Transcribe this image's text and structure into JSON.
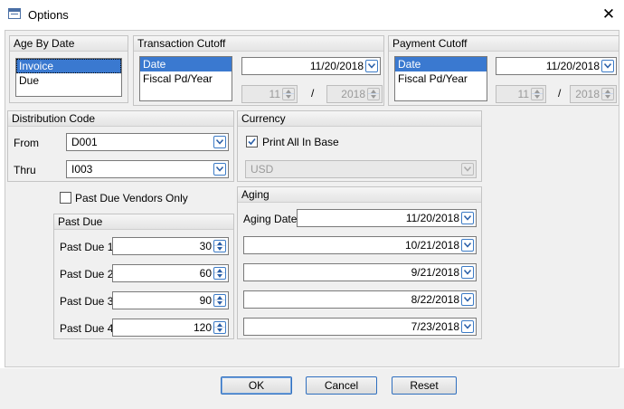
{
  "window": {
    "title": "Options",
    "close_glyph": "✕"
  },
  "age_by_date": {
    "header": "Age By Date",
    "items": [
      {
        "label": "Invoice",
        "selected": true
      },
      {
        "label": "Due",
        "selected": false
      }
    ]
  },
  "transaction_cutoff": {
    "header": "Transaction Cutoff",
    "items": [
      {
        "label": "Date",
        "selected": true
      },
      {
        "label": "Fiscal Pd/Year",
        "selected": false
      }
    ],
    "date": "11/20/2018",
    "period": "11",
    "separator": "/",
    "year": "2018"
  },
  "payment_cutoff": {
    "header": "Payment Cutoff",
    "items": [
      {
        "label": "Date",
        "selected": true
      },
      {
        "label": "Fiscal Pd/Year",
        "selected": false
      }
    ],
    "date": "11/20/2018",
    "period": "11",
    "separator": "/",
    "year": "2018"
  },
  "distribution_code": {
    "header": "Distribution Code",
    "from_label": "From",
    "from_value": "D001",
    "thru_label": "Thru",
    "thru_value": "I003"
  },
  "currency": {
    "header": "Currency",
    "print_all_in_base_label": "Print All In Base",
    "print_all_in_base_checked": true,
    "currency_value": "USD"
  },
  "past_due_vendors_only": {
    "label": "Past Due Vendors Only",
    "checked": false
  },
  "past_due": {
    "header": "Past Due",
    "rows": [
      {
        "label": "Past Due 1",
        "value": "30"
      },
      {
        "label": "Past Due 2",
        "value": "60"
      },
      {
        "label": "Past Due 3",
        "value": "90"
      },
      {
        "label": "Past Due 4",
        "value": "120"
      }
    ]
  },
  "aging": {
    "header": "Aging",
    "aging_date_label": "Aging Date",
    "dates": [
      "11/20/2018",
      "10/21/2018",
      "9/21/2018",
      "8/22/2018",
      "7/23/2018"
    ]
  },
  "buttons": {
    "ok": "OK",
    "cancel": "Cancel",
    "reset": "Reset"
  },
  "colors": {
    "selection": "#3a79d0",
    "button_border": "#2f6fbf",
    "panel": "#f0f0f0"
  },
  "icons": {
    "app": "options-window-icon",
    "dropdown": "chevron-down-icon",
    "spinner": "spin-arrows-icon",
    "check": "check-icon",
    "close": "close-icon"
  }
}
